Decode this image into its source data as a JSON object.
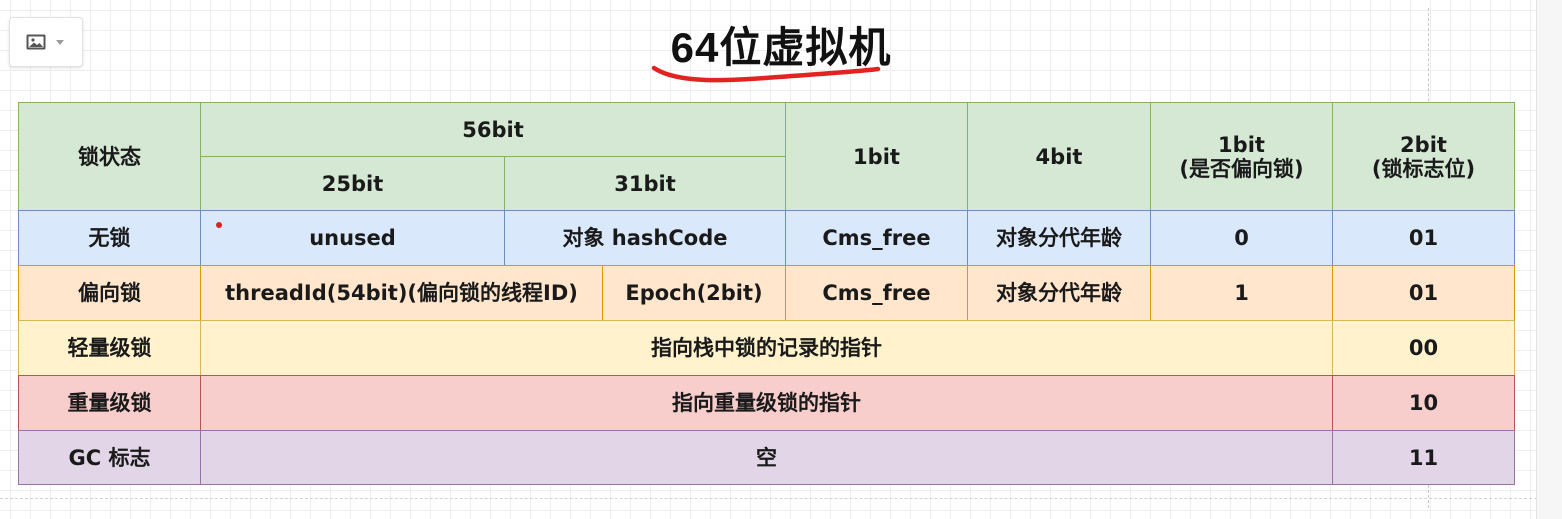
{
  "toolbar": {
    "icon": "image-icon",
    "dropdown_icon": "chevron-down-icon"
  },
  "title": "64位虚拟机",
  "colors": {
    "header_fill": "#d5e8d4",
    "unlocked_fill": "#dae8fc",
    "biased_fill": "#ffe6cc",
    "lightweight_fill": "#fff2cc",
    "heavyweight_fill": "#f8cecc",
    "gc_fill": "#e1d5e7",
    "title_underline": "#e32222"
  },
  "header": {
    "lock_state": "锁状态",
    "bits56": "56bit",
    "bits25": "25bit",
    "bits31": "31bit",
    "bits1": "1bit",
    "bits4": "4bit",
    "biased_flag": "1bit\n(是否偏向锁)",
    "lock_flag": "2bit\n(锁标志位)"
  },
  "rows": {
    "unlocked": {
      "state": "无锁",
      "unused": "unused",
      "hashcode": "对象 hashCode",
      "cms": "Cms_free",
      "age": "对象分代年龄",
      "biased": "0",
      "flag": "01"
    },
    "biased": {
      "state": "偏向锁",
      "thread_id": "threadId(54bit)(偏向锁的线程ID)",
      "epoch": "Epoch(2bit)",
      "cms": "Cms_free",
      "age": "对象分代年龄",
      "biased": "1",
      "flag": "01"
    },
    "lightweight": {
      "state": "轻量级锁",
      "content": "指向栈中锁的记录的指针",
      "flag": "00"
    },
    "heavyweight": {
      "state": "重量级锁",
      "content": "指向重量级锁的指针",
      "flag": "10"
    },
    "gc": {
      "state": "GC 标志",
      "content": "空",
      "flag": "11"
    }
  }
}
